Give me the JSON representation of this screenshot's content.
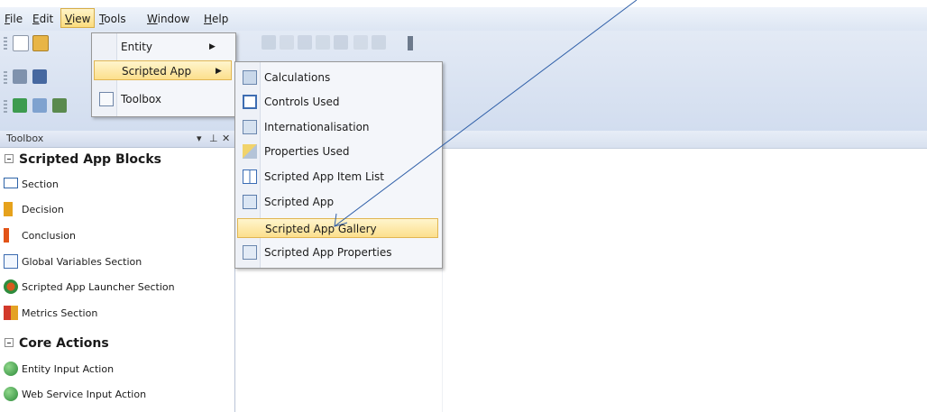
{
  "menubar": {
    "items": [
      "File",
      "Edit",
      "View",
      "Tools",
      "Window",
      "Help"
    ],
    "underline": [
      "F",
      "E",
      "V",
      "T",
      "W",
      "H"
    ],
    "rest": [
      "ile",
      "dit",
      "iew",
      "ools",
      "indow",
      "elp"
    ]
  },
  "view_menu": {
    "items": [
      {
        "label": "Entity"
      },
      {
        "label": "Scripted App"
      },
      {
        "label": "Toolbox"
      }
    ]
  },
  "submenu": {
    "items": [
      {
        "label": "Calculations"
      },
      {
        "label": "Controls Used"
      },
      {
        "label": "Internationalisation"
      },
      {
        "label": "Properties Used"
      },
      {
        "label": "Scripted App Item List"
      },
      {
        "label": "Scripted App"
      },
      {
        "label": "Scripted App Gallery"
      },
      {
        "label": "Scripted App Properties"
      }
    ]
  },
  "toolbox": {
    "title": "Toolbox",
    "categories": [
      {
        "name": "Scripted App Blocks",
        "items": [
          "Section",
          "Decision",
          "Conclusion",
          "Global Variables Section",
          "Scripted App Launcher Section",
          "Metrics Section"
        ]
      },
      {
        "name": "Core Actions",
        "items": [
          "Entity Input Action",
          "Web Service Input Action"
        ]
      }
    ]
  },
  "colors": {
    "highlight": "#fcdf8c",
    "annotation_arrow": "#2f5fa8",
    "chrome": "#dde6f3"
  }
}
